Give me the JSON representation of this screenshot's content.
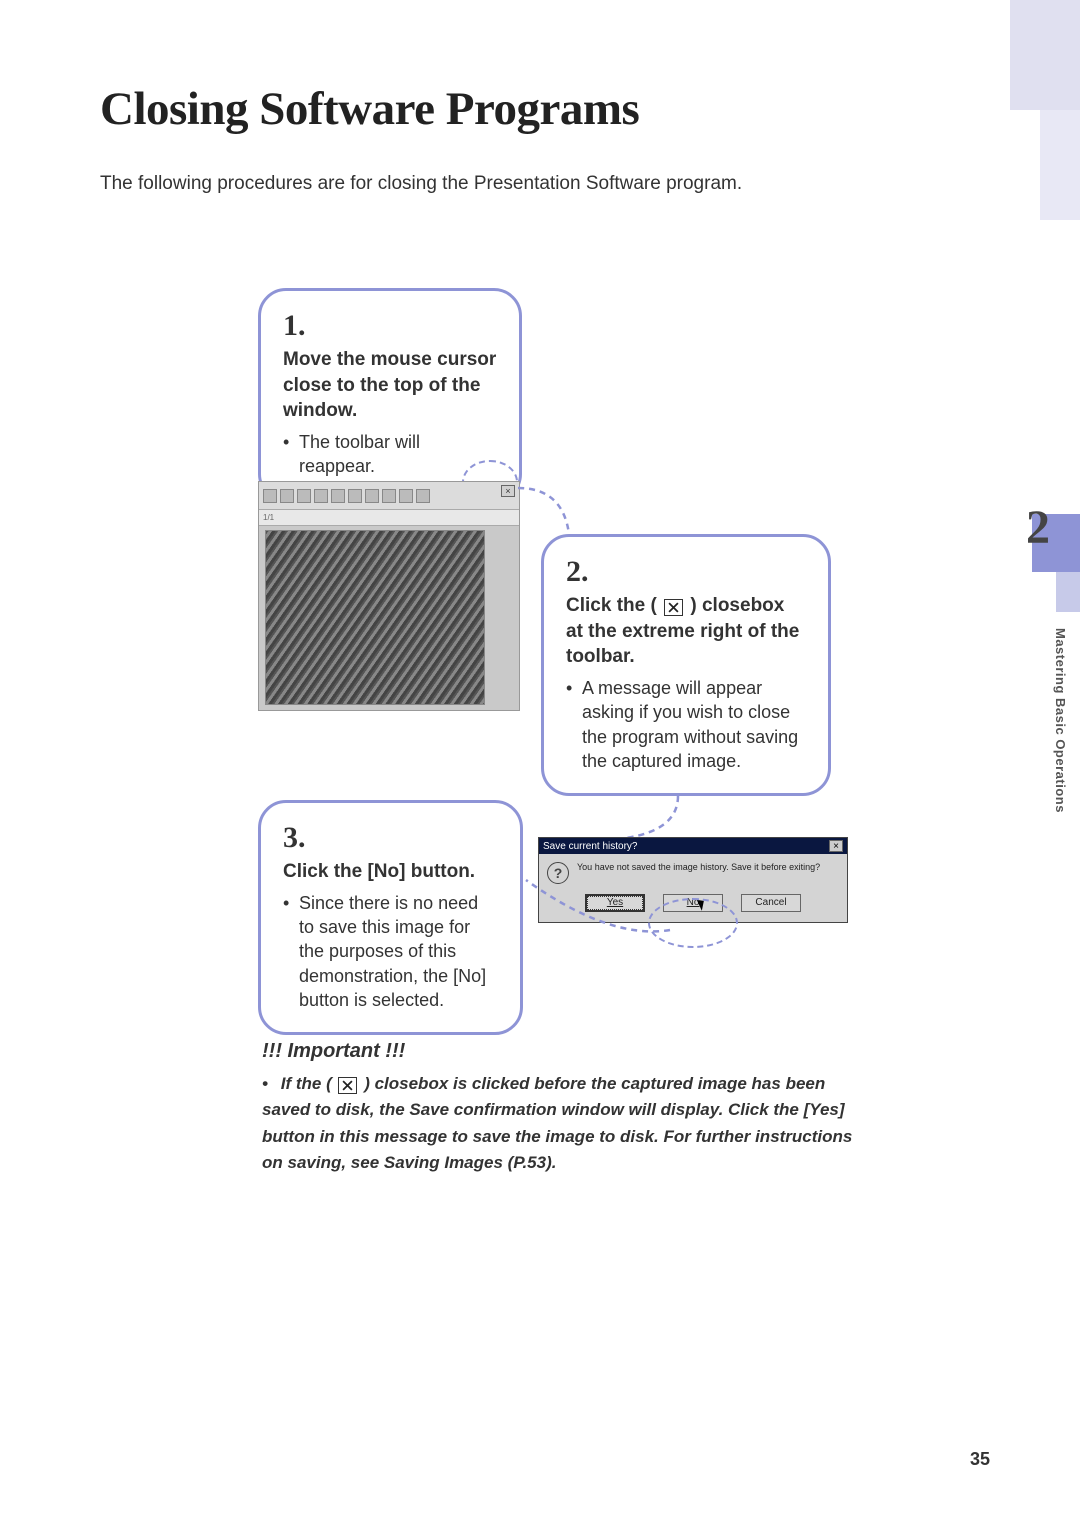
{
  "title": "Closing Software Programs",
  "intro": "The following procedures are for closing the Presentation Software program.",
  "steps": {
    "s1": {
      "num": "1.",
      "head": "Move the mouse cursor close to the top of the window.",
      "body": "The toolbar will reappear."
    },
    "s2": {
      "num": "2.",
      "head_pre": "Click the (",
      "head_post": ") closebox at the extreme right of the toolbar.",
      "body": "A message will appear asking if you wish to close the program without saving the captured image."
    },
    "s3": {
      "num": "3.",
      "head": "Click the [No] button.",
      "body": "Since there is no need to save this image for the purposes of this demonstration, the [No] button is selected."
    }
  },
  "dialog": {
    "title": "Save current history?",
    "message": "You have not saved the image history. Save it before exiting?",
    "yes": "Yes",
    "no": "No",
    "cancel": "Cancel"
  },
  "important": {
    "heading": "!!! Important !!!",
    "body_pre": "If the (",
    "body_post": ") closebox is clicked before the captured image has been saved to disk, the Save confirmation window will display. Click the [Yes] button in this message to save the image to disk. For further instructions on saving, see Saving Images (P.53)."
  },
  "chapter": {
    "number": "2",
    "label": "Mastering Basic Operations"
  },
  "page_number": "35"
}
